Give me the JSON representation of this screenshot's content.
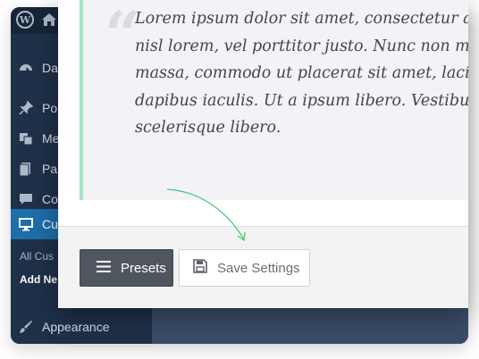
{
  "admin": {
    "sidebar_items": [
      {
        "label": "Da",
        "icon": "dashboard-icon"
      },
      {
        "label": "Po",
        "icon": "pin-icon"
      },
      {
        "label": "Me",
        "icon": "media-icon"
      },
      {
        "label": "Pa",
        "icon": "pages-icon"
      },
      {
        "label": "Co",
        "icon": "comments-icon"
      },
      {
        "label": "Cu",
        "icon": "customize-icon"
      }
    ],
    "submenu": {
      "all": "All Cus",
      "add": "Add Ne"
    },
    "appearance": "Appearance",
    "wp_logo": "W"
  },
  "panel": {
    "quote_mark": "“",
    "quote_text": "Lorem ipsum dolor sit amet, consectetur adipiscing elit. Integer\nnisl lorem, vel porttitor justo. Nunc non mauris\nmassa, commodo ut placerat sit amet, lacinia\ndapibus iaculis. Ut a ipsum libero. Vestibulum\nscelerisque libero.",
    "presets_label": "Presets",
    "save_label": "Save Settings"
  },
  "colors": {
    "accent_active": "#1e6ea8",
    "quote_border": "#a3e4c6",
    "arrow": "#4cc97a",
    "presets_bg": "#50565f"
  }
}
